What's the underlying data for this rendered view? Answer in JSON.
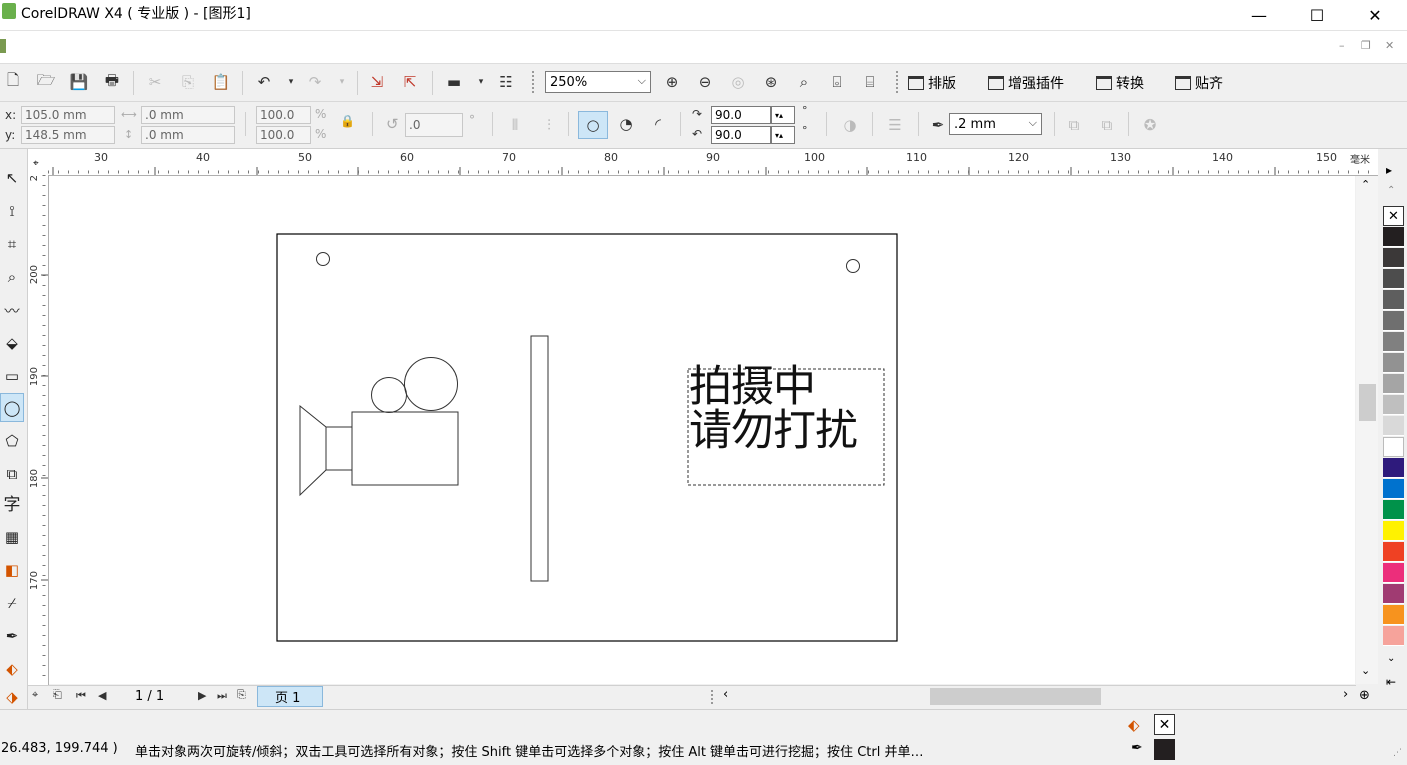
{
  "window": {
    "title": "CorelDRAW X4 ( 专业版 ) - [图形1]",
    "minimize": "—",
    "maximize": "☐",
    "close": "✕",
    "doc_min": "–",
    "doc_restore": "❐",
    "doc_close": "✕"
  },
  "toolbar": {
    "zoom_value": "250%",
    "plugins": [
      "排版",
      "增强插件",
      "转换",
      "贴齐"
    ]
  },
  "propertybar": {
    "x_label": "x:",
    "x_value": "105.0 mm",
    "y_label": "y:",
    "y_value": "148.5 mm",
    "w_value": ".0 mm",
    "h_value": ".0 mm",
    "scale_x": "100.0",
    "scale_y": "100.0",
    "pct": "%",
    "rotation": ".0",
    "deg": "°",
    "start_angle": "90.0",
    "end_angle": "90.0",
    "outline_width": ".2 mm"
  },
  "ruler": {
    "unit": "毫米",
    "h_ticks": [
      "30",
      "40",
      "50",
      "60",
      "70",
      "80",
      "90",
      "100",
      "110",
      "120",
      "130",
      "140",
      "150"
    ],
    "v_ticks": [
      "200",
      "190",
      "180",
      "170"
    ],
    "corner_v": "2"
  },
  "canvas": {
    "sign_text_line1": "拍摄中",
    "sign_text_line2": "请勿打扰"
  },
  "toolbox": {
    "text_tool_glyph": "字"
  },
  "page_nav": {
    "counter": "1 / 1",
    "tab": "页 1"
  },
  "palette": {
    "colors": [
      "#231f20",
      "#3b3838",
      "#4d4d4d",
      "#5e5e5e",
      "#6f6f6f",
      "#808080",
      "#929292",
      "#a5a5a5",
      "#bfbfbf",
      "#d9d9d9",
      "#ffffff",
      "#2e1a7c",
      "#0072ce",
      "#00924a",
      "#fff200",
      "#ef4123",
      "#ec2e7b",
      "#a03b72",
      "#f7931e",
      "#f6a39b"
    ]
  },
  "status": {
    "coords": "26.483, 199.744 )",
    "hint": "单击对象两次可旋转/倾斜；双击工具可选择所有对象；按住 Shift 键单击可选择多个对象；按住 Alt 键单击可进行挖掘；按住 Ctrl 并单…"
  }
}
